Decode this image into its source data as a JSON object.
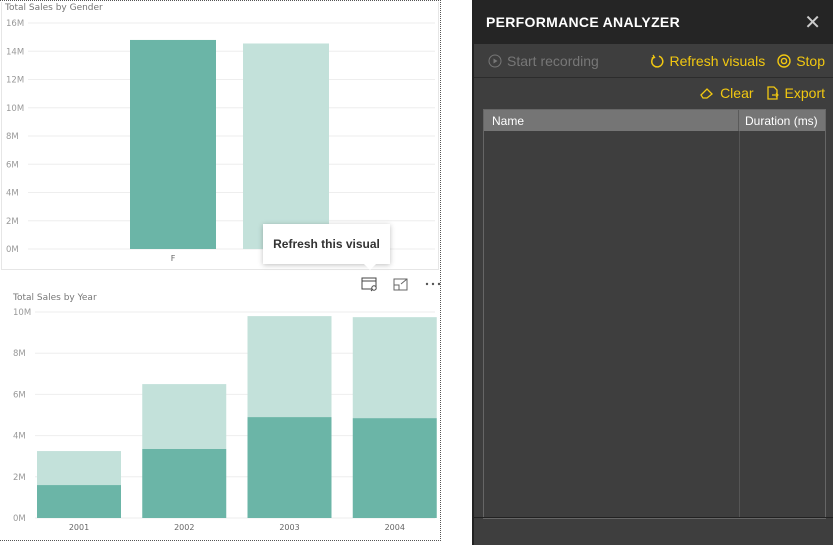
{
  "colors": {
    "female": "#6bb5a7",
    "male": "#c3e1da",
    "gold": "#f2c811"
  },
  "chart_data": [
    {
      "type": "bar",
      "title": "Total Sales by Gender",
      "categories": [
        "F",
        ""
      ],
      "values": [
        14.8,
        14.55
      ],
      "unit": "M",
      "yticks": [
        "0M",
        "2M",
        "4M",
        "6M",
        "8M",
        "10M",
        "12M",
        "14M",
        "16M"
      ],
      "ylim": [
        0,
        16
      ],
      "grid": true
    },
    {
      "type": "bar",
      "stacked": true,
      "title": "Total Sales by Year",
      "categories": [
        "2001",
        "2002",
        "2003",
        "2004"
      ],
      "series": [
        {
          "values": [
            1.6,
            3.35,
            4.9,
            4.85
          ]
        },
        {
          "values": [
            1.65,
            3.15,
            4.9,
            4.9
          ]
        }
      ],
      "unit": "M",
      "yticks": [
        "0M",
        "2M",
        "4M",
        "6M",
        "8M",
        "10M"
      ],
      "ylim": [
        0,
        10
      ],
      "grid": true
    }
  ],
  "tooltip": "Refresh this visual",
  "visual_icons": [
    "refresh-visual-icon",
    "focus-mode-icon",
    "more-options-icon"
  ],
  "pane": {
    "title": "PERFORMANCE ANALYZER",
    "start_recording": "Start recording",
    "refresh_visuals": "Refresh visuals",
    "stop": "Stop",
    "clear": "Clear",
    "export": "Export",
    "columns": [
      "Name",
      "Duration (ms)"
    ]
  }
}
